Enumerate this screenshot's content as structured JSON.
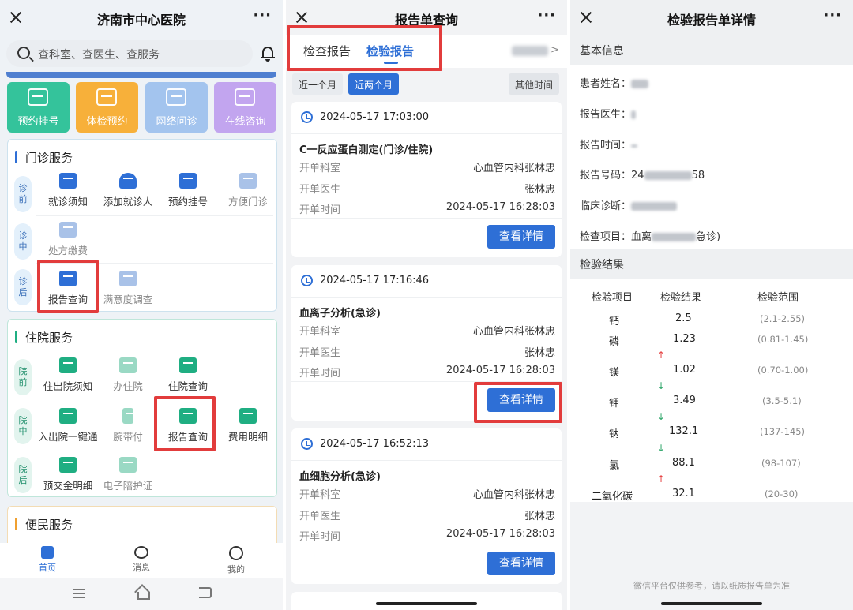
{
  "panel1": {
    "title": "济南市中心医院",
    "search_placeholder": "查科室、查医生、查服务",
    "tiles": [
      "预约挂号",
      "体检预约",
      "网络问诊",
      "在线咨询"
    ],
    "outpatient": {
      "title": "门诊服务",
      "stage_before": "诊\n前",
      "stage_mid": "诊\n中",
      "stage_after": "诊\n后",
      "before_items": [
        "就诊须知",
        "添加就诊人",
        "预约挂号",
        "方便门诊"
      ],
      "mid_items": [
        "处方缴费"
      ],
      "after_items": [
        "报告查询",
        "满意度调查"
      ]
    },
    "inpatient": {
      "title": "住院服务",
      "stage_before": "院\n前",
      "stage_mid": "院\n中",
      "stage_after": "院\n后",
      "before_items": [
        "住出院须知",
        "办住院",
        "住院查询"
      ],
      "mid_items": [
        "入出院一键通",
        "腕带付",
        "报告查询",
        "费用明细"
      ],
      "after_items": [
        "预交金明细",
        "电子陪护证"
      ]
    },
    "convenience_title": "便民服务",
    "tabbar": [
      "首页",
      "消息",
      "我的"
    ],
    "colors": {
      "accent": "#2e6fd6",
      "tile_green": "#34c39b",
      "tile_orange": "#f7b03a",
      "tile_blue": "#a3c4ee",
      "tile_purple": "#c2a5ef"
    }
  },
  "panel2": {
    "title": "报告单查询",
    "tab_exam": "检查报告",
    "tab_lab": "检验报告",
    "filter_1m": "近一个月",
    "filter_2m": "近两个月",
    "filter_other": "其他时间",
    "label_dept": "开单科室",
    "label_doctor": "开单医生",
    "label_time": "开单时间",
    "detail_button": "查看详情",
    "reports": [
      {
        "time": "2024-05-17 17:03:00",
        "name": "C一反应蛋白测定(门诊/住院)",
        "dept": "心血管内科张林忠",
        "doctor": "张林忠",
        "order_time": "2024-05-17 16:28:03"
      },
      {
        "time": "2024-05-17 17:16:46",
        "name": "血离子分析(急诊)",
        "dept": "心血管内科张林忠",
        "doctor": "张林忠",
        "order_time": "2024-05-17 16:28:03"
      },
      {
        "time": "2024-05-17 16:52:13",
        "name": "血细胞分析(急诊)",
        "dept": "心血管内科张林忠",
        "doctor": "张林忠",
        "order_time": "2024-05-17 16:28:03"
      }
    ]
  },
  "panel3": {
    "title": "检验报告单详情",
    "basic_info": "基本信息",
    "patient_name": "患者姓名：",
    "report_doctor": "报告医生：",
    "report_time": "报告时间：",
    "report_no": "报告号码：",
    "report_no_start": "24",
    "report_no_end": "58",
    "diagnosis": "临床诊断：",
    "exam_item": "检查项目：",
    "exam_item_start": "血离",
    "exam_item_end": "急诊)",
    "results_title": "检验结果",
    "col_item": "检验项目",
    "col_result": "检验结果",
    "col_range": "检验范围",
    "rows": [
      {
        "item": "钙",
        "result": "2.5",
        "range": "(2.1-2.55)"
      },
      {
        "item": "磷",
        "result": "1.23",
        "range": "(0.81-1.45)"
      },
      {
        "item": "镁",
        "result": "1.02",
        "range": "(0.70-1.00)"
      },
      {
        "item": "钾",
        "result": "3.49",
        "range": "(3.5-5.1)"
      },
      {
        "item": "钠",
        "result": "132.1",
        "range": "(137-145)"
      },
      {
        "item": "氯",
        "result": "88.1",
        "range": "(98-107)"
      },
      {
        "item": "二氧化碳",
        "result": "32.1",
        "range": "(20-30)"
      }
    ],
    "arrows": [
      "↑",
      "↓",
      "↓",
      "↓",
      "↑"
    ],
    "footer": "微信平台仅供参考，请以纸质报告单为准"
  }
}
